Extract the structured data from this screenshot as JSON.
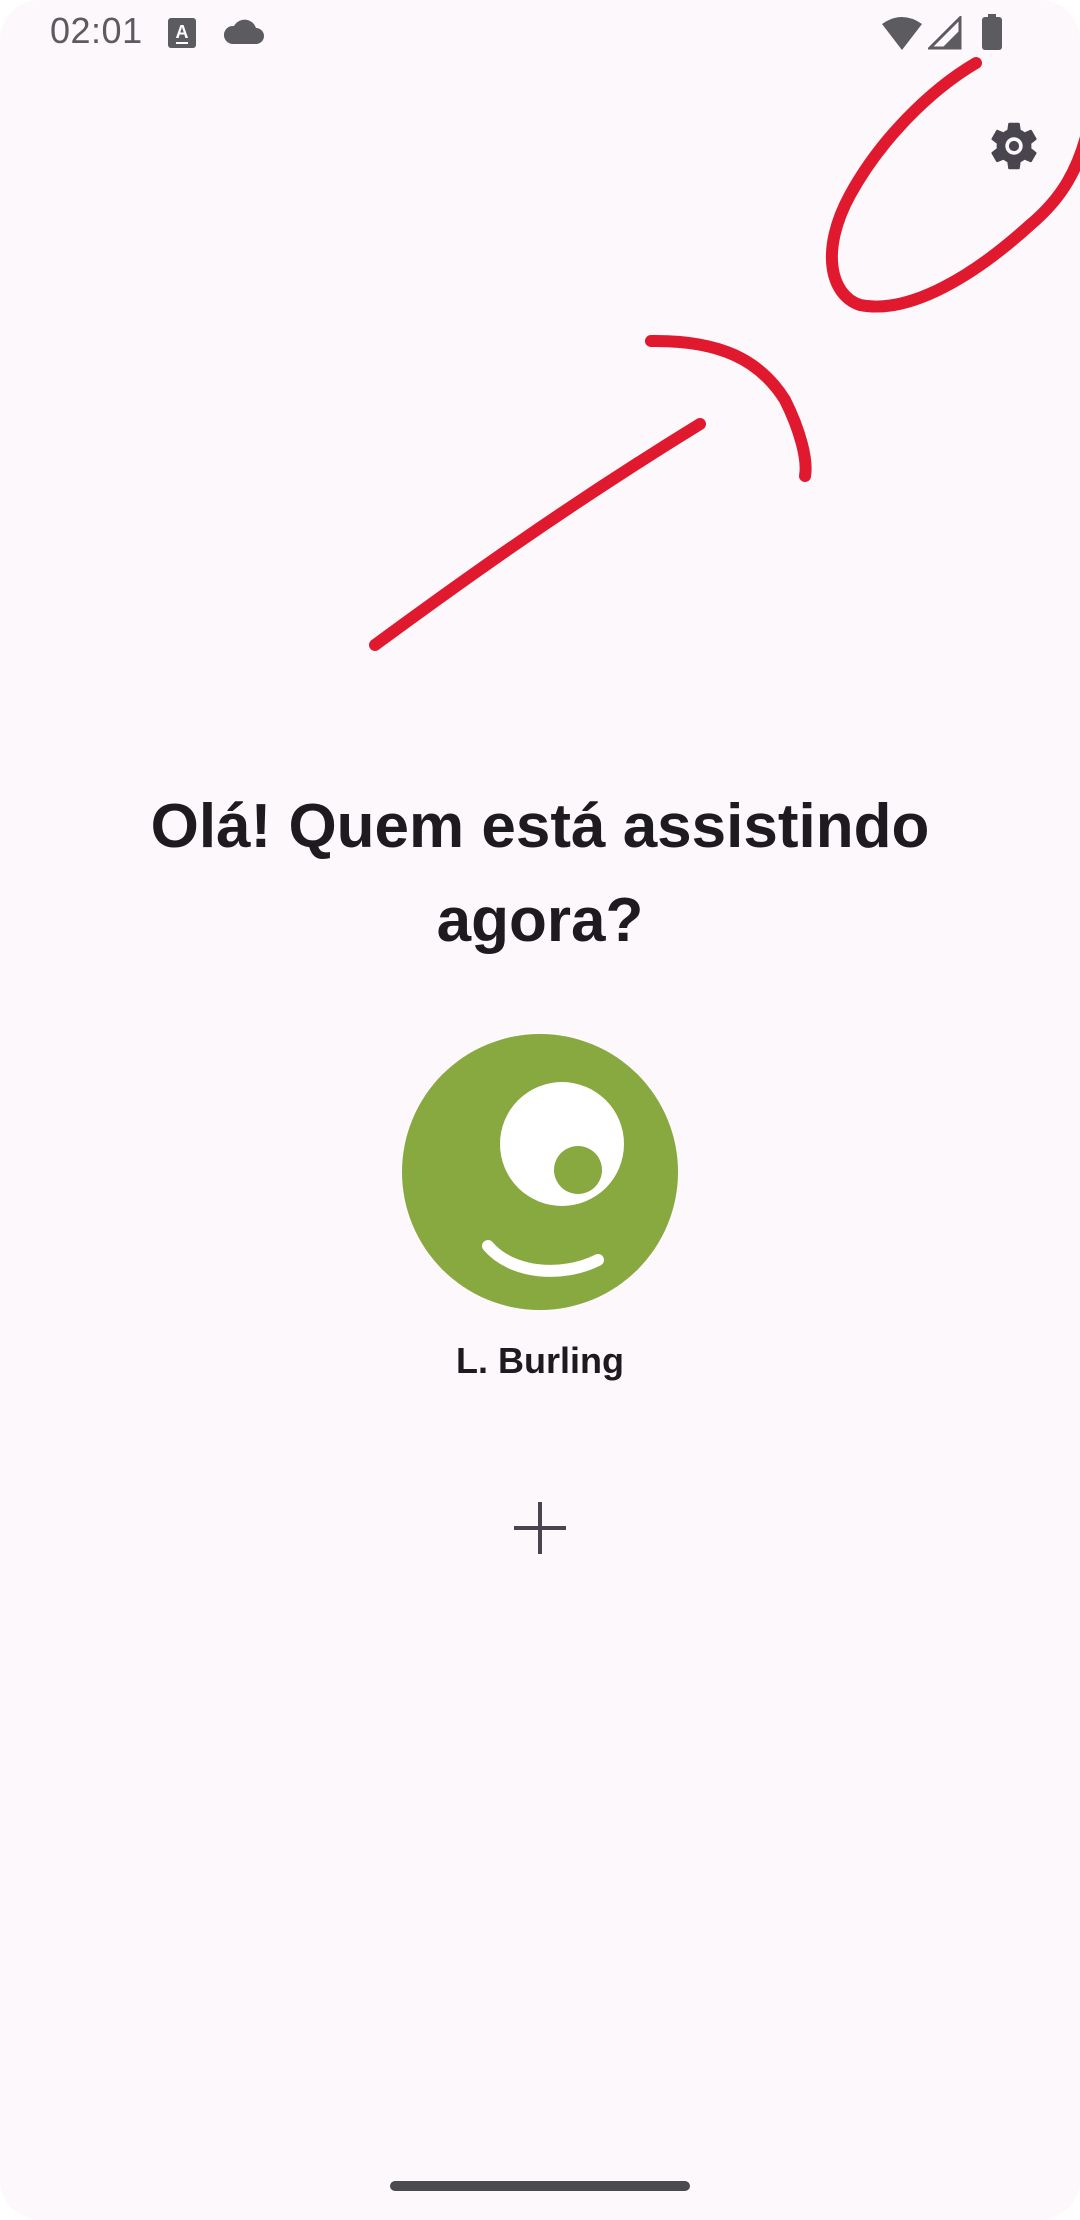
{
  "status_bar": {
    "time": "02:01",
    "icons": [
      "font-a-icon",
      "cloud-icon",
      "wifi-icon",
      "signal-icon",
      "battery-icon"
    ]
  },
  "toolbar": {
    "settings_icon": "gear-icon"
  },
  "greeting": {
    "title": "Olá! Quem está assistindo agora?"
  },
  "profiles": [
    {
      "name": "L. Burling",
      "avatar_color": "#88a840"
    }
  ],
  "add_profile": {
    "icon": "plus-icon"
  },
  "colors": {
    "background": "#fdf8fc",
    "text": "#1d1b20",
    "annotation": "#e0192f"
  }
}
